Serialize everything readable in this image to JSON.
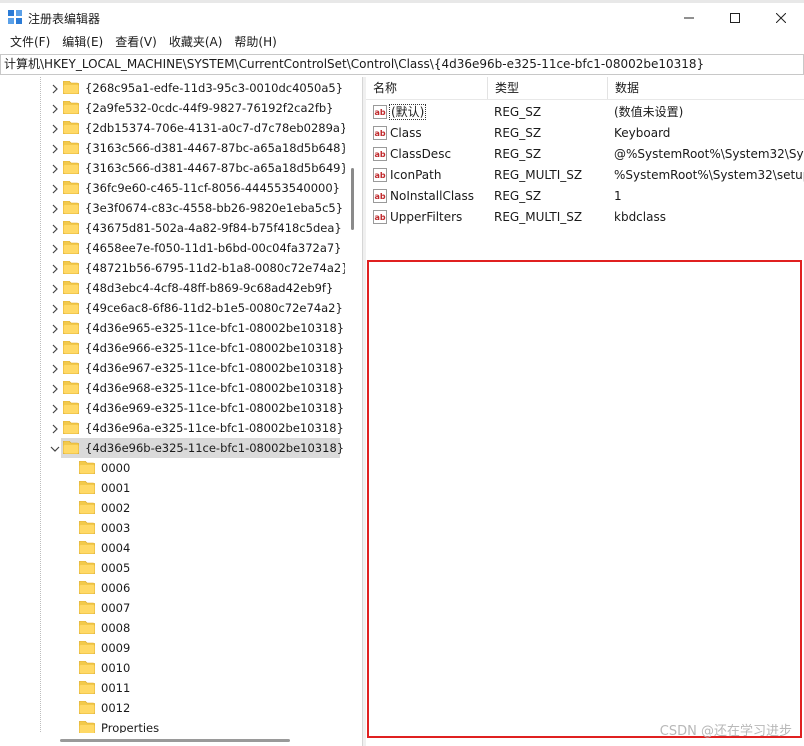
{
  "window": {
    "title": "注册表编辑器",
    "minimize": "minimize",
    "maximize": "maximize",
    "close": "close"
  },
  "menu": [
    "文件(F)",
    "编辑(E)",
    "查看(V)",
    "收藏夹(A)",
    "帮助(H)"
  ],
  "address": "计算机\\HKEY_LOCAL_MACHINE\\SYSTEM\\CurrentControlSet\\Control\\Class\\{4d36e96b-e325-11ce-bfc1-08002be10318}",
  "tree": {
    "class_keys": [
      "{268c95a1-edfe-11d3-95c3-0010dc4050a5}",
      "{2a9fe532-0cdc-44f9-9827-76192f2ca2fb}",
      "{2db15374-706e-4131-a0c7-d7c78eb0289a}",
      "{3163c566-d381-4467-87bc-a65a18d5b648}",
      "{3163c566-d381-4467-87bc-a65a18d5b649}",
      "{36fc9e60-c465-11cf-8056-444553540000}",
      "{3e3f0674-c83c-4558-bb26-9820e1eba5c5}",
      "{43675d81-502a-4a82-9f84-b75f418c5dea}",
      "{4658ee7e-f050-11d1-b6bd-00c04fa372a7}",
      "{48721b56-6795-11d2-b1a8-0080c72e74a2}",
      "{48d3ebc4-4cf8-48ff-b869-9c68ad42eb9f}",
      "{49ce6ac8-6f86-11d2-b1e5-0080c72e74a2}",
      "{4d36e965-e325-11ce-bfc1-08002be10318}",
      "{4d36e966-e325-11ce-bfc1-08002be10318}",
      "{4d36e967-e325-11ce-bfc1-08002be10318}",
      "{4d36e968-e325-11ce-bfc1-08002be10318}",
      "{4d36e969-e325-11ce-bfc1-08002be10318}",
      "{4d36e96a-e325-11ce-bfc1-08002be10318}"
    ],
    "selected_key": "{4d36e96b-e325-11ce-bfc1-08002be10318}",
    "subkeys": [
      "0000",
      "0001",
      "0002",
      "0003",
      "0004",
      "0005",
      "0006",
      "0007",
      "0008",
      "0009",
      "0010",
      "0011",
      "0012",
      "Properties"
    ]
  },
  "values": {
    "headers": [
      "名称",
      "类型",
      "数据"
    ],
    "rows": [
      {
        "name": "(默认)",
        "type": "REG_SZ",
        "data": "(数值未设置)"
      },
      {
        "name": "Class",
        "type": "REG_SZ",
        "data": "Keyboard"
      },
      {
        "name": "ClassDesc",
        "type": "REG_SZ",
        "data": "@%SystemRoot%\\System32\\Sys"
      },
      {
        "name": "IconPath",
        "type": "REG_MULTI_SZ",
        "data": "%SystemRoot%\\System32\\setup"
      },
      {
        "name": "NoInstallClass",
        "type": "REG_SZ",
        "data": "1"
      },
      {
        "name": "UpperFilters",
        "type": "REG_MULTI_SZ",
        "data": "kbdclass"
      }
    ]
  },
  "watermark": "CSDN @还在学习进步",
  "colors": {
    "folder": "#f2c94c",
    "selection": "#dadada",
    "highlight_box": "#e02020"
  }
}
